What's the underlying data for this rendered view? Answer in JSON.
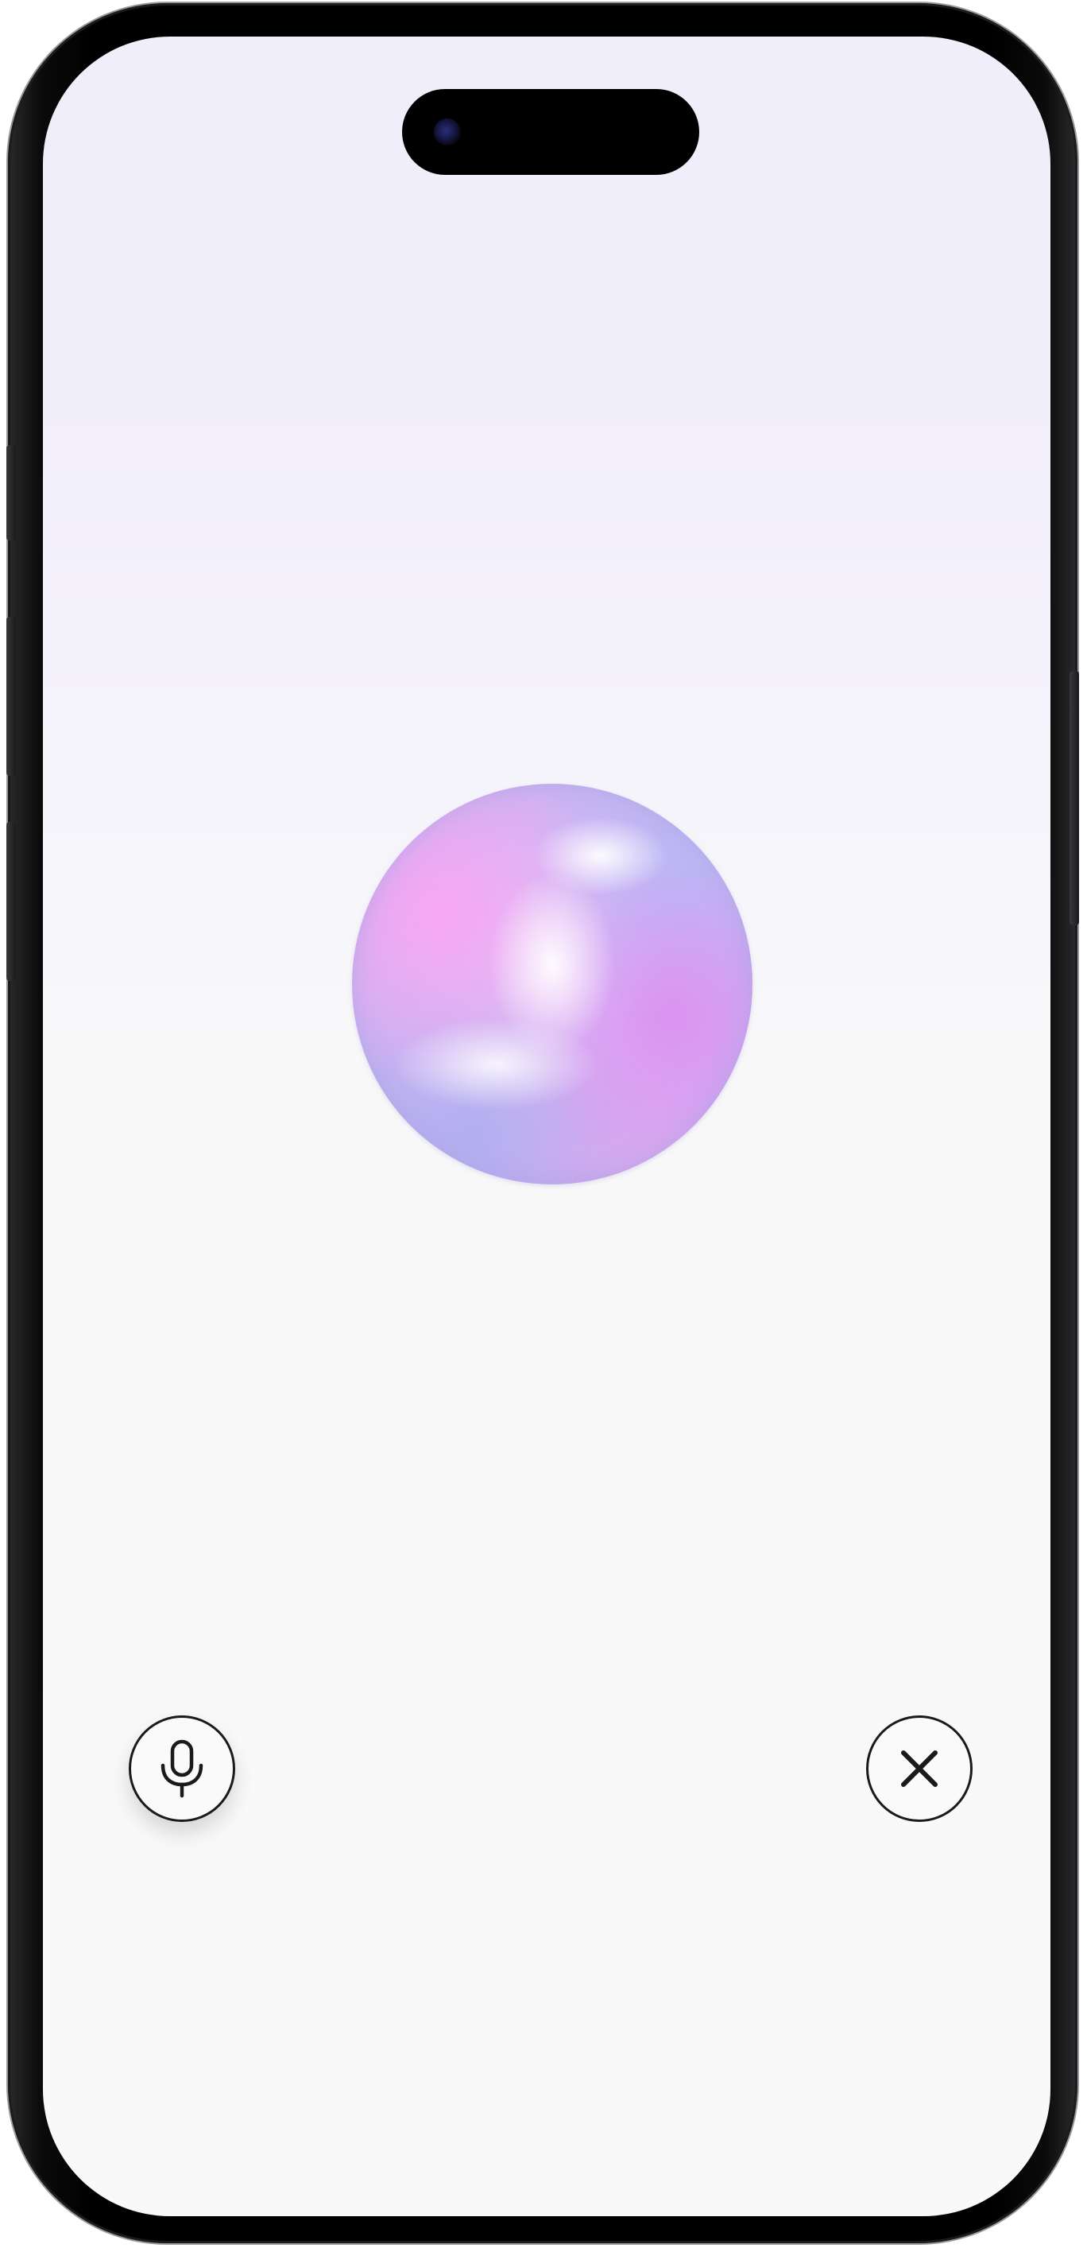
{
  "screen": {
    "background_top": "#f1eefc",
    "background_bottom": "#f9f9f9"
  },
  "assistant_orb": {
    "colors": [
      "#f7a6f3",
      "#dc92f1",
      "#b9b9f5",
      "#ffffff"
    ]
  },
  "controls": {
    "mic_button": {
      "icon": "microphone-icon"
    },
    "close_button": {
      "icon": "close-icon"
    }
  }
}
